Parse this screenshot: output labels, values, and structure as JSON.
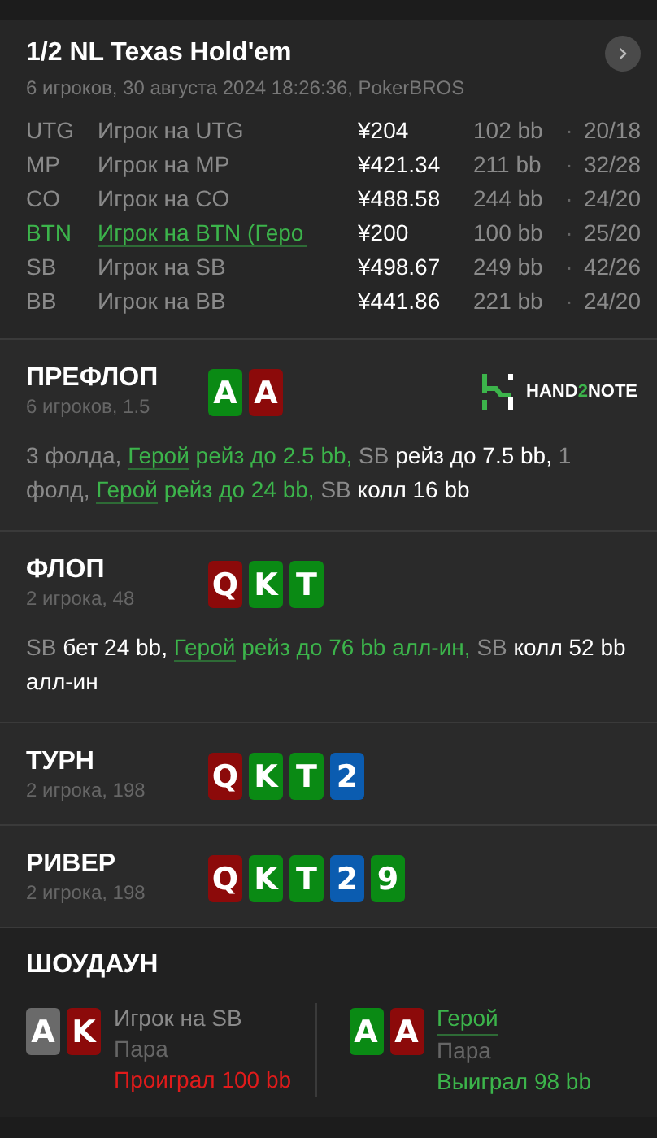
{
  "header": {
    "title": "1/2 NL Texas Hold'em",
    "subtitle": "6 игроков, 30 августа 2024 18:26:36, PokerBROS",
    "next_button": "›",
    "players": [
      {
        "position": "UTG",
        "name": "Игрок на UTG",
        "stack": "¥204",
        "bb": "102 bb",
        "stats": "20/18",
        "separator": "·",
        "hero": false
      },
      {
        "position": "MP",
        "name": "Игрок на MP",
        "stack": "¥421.34",
        "bb": "211 bb",
        "stats": "32/28",
        "separator": "·",
        "hero": false
      },
      {
        "position": "CO",
        "name": "Игрок на CO",
        "stack": "¥488.58",
        "bb": "244 bb",
        "stats": "24/20",
        "separator": "·",
        "hero": false
      },
      {
        "position": "BTN",
        "name": "Игрок на BTN (Геро",
        "stack": "¥200",
        "bb": "100 bb",
        "stats": "25/20",
        "separator": "·",
        "hero": true
      },
      {
        "position": "SB",
        "name": "Игрок на SB",
        "stack": "¥498.67",
        "bb": "249 bb",
        "stats": "42/26",
        "separator": "·",
        "hero": false
      },
      {
        "position": "BB",
        "name": "Игрок на BB",
        "stack": "¥441.86",
        "bb": "221 bb",
        "stats": "24/20",
        "separator": "·",
        "hero": false
      }
    ]
  },
  "streets": [
    {
      "title": "ПРЕФЛОП",
      "info": "6 игроков, 1.5",
      "cards": [
        {
          "rank": "A",
          "color": "#0a8a14"
        },
        {
          "rank": "A",
          "color": "#8c0a0a"
        }
      ],
      "logo": [
        {
          "text": "HAND",
          "accent": false
        },
        {
          "text": "2",
          "accent": true
        },
        {
          "text": "NOTE",
          "accent": false
        }
      ],
      "actions": [
        {
          "kind": "muted",
          "text": "3 фолда, "
        },
        {
          "kind": "hero_link",
          "text": "Герой"
        },
        {
          "kind": "hero",
          "text": " рейз до 2.5 bb, "
        },
        {
          "kind": "muted",
          "text": "SB"
        },
        {
          "kind": "action",
          "text": " рейз до 7.5 bb, "
        },
        {
          "kind": "muted",
          "text": "1 фолд, "
        },
        {
          "kind": "hero_link",
          "text": "Герой"
        },
        {
          "kind": "hero",
          "text": " рейз до 24 bb, "
        },
        {
          "kind": "muted",
          "text": "SB"
        },
        {
          "kind": "action",
          "text": " колл 16 bb"
        }
      ]
    },
    {
      "title": "ФЛОП",
      "info": "2 игрока, 48",
      "cards": [
        {
          "rank": "Q",
          "color": "#8c0a0a"
        },
        {
          "rank": "K",
          "color": "#0a8a14"
        },
        {
          "rank": "T",
          "color": "#0a8a14"
        }
      ],
      "actions": [
        {
          "kind": "muted",
          "text": "SB"
        },
        {
          "kind": "action",
          "text": " бет 24 bb, "
        },
        {
          "kind": "hero_link",
          "text": "Герой"
        },
        {
          "kind": "hero",
          "text": " рейз до 76 bb алл-ин, "
        },
        {
          "kind": "muted",
          "text": "SB"
        },
        {
          "kind": "action",
          "text": " колл 52 bb алл-ин"
        }
      ]
    },
    {
      "title": "ТУРН",
      "info": "2 игрока, 198",
      "cards": [
        {
          "rank": "Q",
          "color": "#8c0a0a"
        },
        {
          "rank": "K",
          "color": "#0a8a14"
        },
        {
          "rank": "T",
          "color": "#0a8a14"
        },
        {
          "rank": "2",
          "color": "#0b5cb0"
        }
      ]
    },
    {
      "title": "РИВЕР",
      "info": "2 игрока, 198",
      "cards": [
        {
          "rank": "Q",
          "color": "#8c0a0a"
        },
        {
          "rank": "K",
          "color": "#0a8a14"
        },
        {
          "rank": "T",
          "color": "#0a8a14"
        },
        {
          "rank": "2",
          "color": "#0b5cb0"
        },
        {
          "rank": "9",
          "color": "#0a8a14"
        }
      ]
    }
  ],
  "showdown": {
    "title": "ШОУДАУН",
    "players": [
      {
        "name": "Игрок на SB",
        "hero": false,
        "hand": "Пара",
        "result": "Проиграл 100 bb",
        "won": false,
        "cards": [
          {
            "rank": "A",
            "color": "#6a6a6a"
          },
          {
            "rank": "K",
            "color": "#8c0a0a"
          }
        ]
      },
      {
        "name": "Герой",
        "hero": true,
        "hand": "Пара",
        "result": "Выиграл 98 bb",
        "won": true,
        "cards": [
          {
            "rank": "A",
            "color": "#0a8a14"
          },
          {
            "rank": "A",
            "color": "#8c0a0a"
          }
        ]
      }
    ]
  }
}
